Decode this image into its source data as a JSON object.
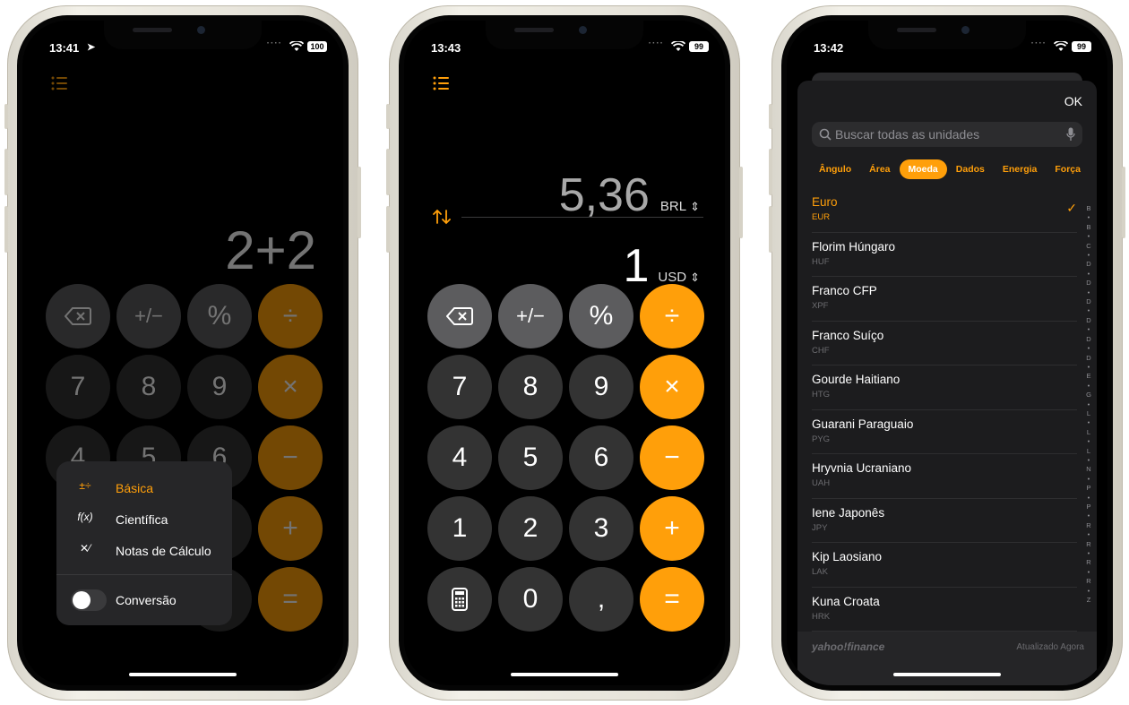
{
  "phone1": {
    "time": "13:41",
    "battery": "100",
    "expression": "2+2",
    "keys": {
      "row1": [
        "⌫",
        "+/−",
        "%",
        "÷"
      ],
      "row2": [
        "7",
        "8",
        "9",
        "×"
      ],
      "row3": [
        "4",
        "5",
        "6",
        "−"
      ],
      "row4": [
        "+"
      ],
      "row5": [
        "="
      ]
    },
    "menu": {
      "items": [
        {
          "icon": "±÷",
          "label": "Básica",
          "selected": true
        },
        {
          "icon": "f(x)",
          "label": "Científica",
          "selected": false
        },
        {
          "icon": "✕⁄",
          "label": "Notas de Cálculo",
          "selected": false
        }
      ],
      "toggle_label": "Conversão",
      "toggle_on": false
    }
  },
  "phone2": {
    "time": "13:43",
    "battery": "99",
    "top_value": "5,36",
    "top_currency": "BRL",
    "bottom_value": "1",
    "bottom_currency": "USD",
    "keys": {
      "row1": [
        "⌫",
        "+/−",
        "%",
        "÷"
      ],
      "row2": [
        "7",
        "8",
        "9",
        "×"
      ],
      "row3": [
        "4",
        "5",
        "6",
        "−"
      ],
      "row4": [
        "1",
        "2",
        "3",
        "+"
      ],
      "row5": [
        "calculator-icon",
        "0",
        ",",
        "="
      ]
    }
  },
  "phone3": {
    "time": "13:42",
    "battery": "99",
    "ok_label": "OK",
    "search_placeholder": "Buscar todas as unidades",
    "categories": [
      {
        "label": "Ângulo",
        "selected": false
      },
      {
        "label": "Área",
        "selected": false
      },
      {
        "label": "Moeda",
        "selected": true
      },
      {
        "label": "Dados",
        "selected": false
      },
      {
        "label": "Energia",
        "selected": false
      },
      {
        "label": "Força",
        "selected": false
      }
    ],
    "currencies": [
      {
        "name": "Euro",
        "code": "EUR",
        "selected": true
      },
      {
        "name": "Florim Húngaro",
        "code": "HUF",
        "selected": false
      },
      {
        "name": "Franco CFP",
        "code": "XPF",
        "selected": false
      },
      {
        "name": "Franco Suíço",
        "code": "CHF",
        "selected": false
      },
      {
        "name": "Gourde Haitiano",
        "code": "HTG",
        "selected": false
      },
      {
        "name": "Guarani Paraguaio",
        "code": "PYG",
        "selected": false
      },
      {
        "name": "Hryvnia Ucraniano",
        "code": "UAH",
        "selected": false
      },
      {
        "name": "Iene Japonês",
        "code": "JPY",
        "selected": false
      },
      {
        "name": "Kip Laosiano",
        "code": "LAK",
        "selected": false
      },
      {
        "name": "Kuna Croata",
        "code": "HRK",
        "selected": false
      }
    ],
    "index_letters": [
      "B",
      "•",
      "B",
      "•",
      "C",
      "•",
      "D",
      "•",
      "D",
      "•",
      "D",
      "•",
      "D",
      "•",
      "D",
      "•",
      "D",
      "•",
      "E",
      "•",
      "G",
      "•",
      "L",
      "•",
      "L",
      "•",
      "L",
      "•",
      "N",
      "•",
      "P",
      "•",
      "P",
      "•",
      "R",
      "•",
      "R",
      "•",
      "R",
      "•",
      "R",
      "•",
      "Z"
    ],
    "footer_source": "yahoo!finance",
    "footer_updated": "Atualizado Agora"
  },
  "colors": {
    "accent": "#ff9f0a",
    "key_dark": "#333333",
    "key_function": "#5c5c5e",
    "background": "#000000"
  }
}
